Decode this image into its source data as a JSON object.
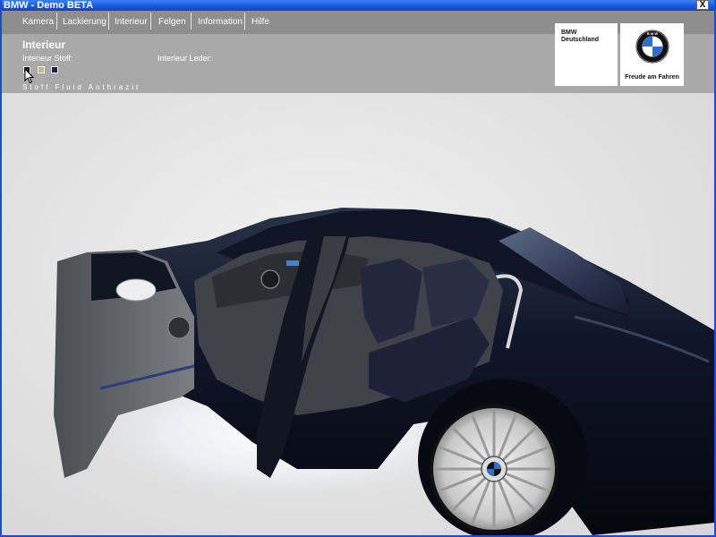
{
  "window": {
    "title": "BMW - Demo BETA",
    "close_label": "X"
  },
  "menu": {
    "items": [
      {
        "label": "Kamera"
      },
      {
        "label": "Lackierung"
      },
      {
        "label": "Interieur"
      },
      {
        "label": "Felgen"
      },
      {
        "label": "Information"
      },
      {
        "label": "Hilfe"
      }
    ]
  },
  "interior": {
    "title": "Interieur",
    "fabric_label": "Interieur Stoff:",
    "leather_label": "Interieur Leder:",
    "swatches": [
      {
        "color": "#1a1a1a",
        "selected": true
      },
      {
        "color": "#c8b48a",
        "selected": false
      },
      {
        "color": "#1c2447",
        "selected": false
      }
    ],
    "selected_material": "Stoff Fluid Anthrazit"
  },
  "branding": {
    "company_line1": "BMW",
    "company_line2": "Deutschland",
    "slogan": "Freude am Fahren",
    "logo_icon": "bmw-roundel-icon"
  },
  "colors": {
    "car_paint": "#0d1220",
    "panel_bg": "#a9a9a9",
    "menubar_bg": "#8e8e8e"
  }
}
